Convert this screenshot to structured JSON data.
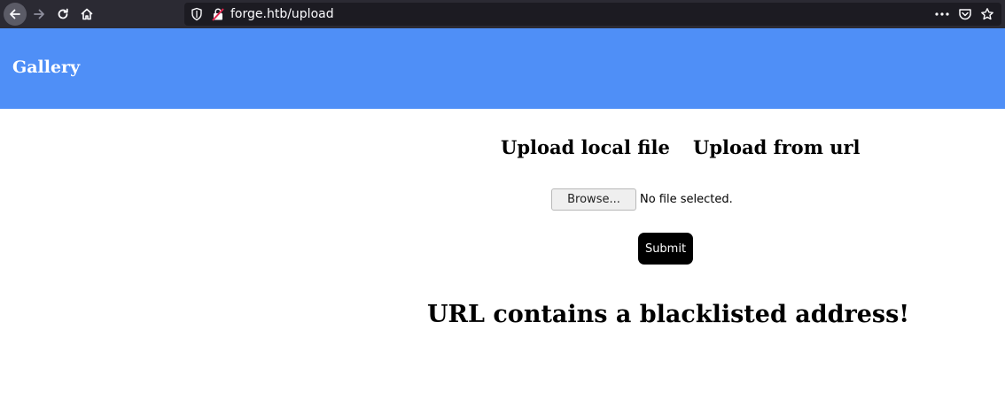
{
  "browser": {
    "url": "forge.htb/upload",
    "icons": {
      "back": "back-arrow-icon",
      "forward": "forward-arrow-icon",
      "reload": "reload-icon",
      "home": "home-icon",
      "tracking": "shield-icon",
      "security": "insecure-lock-icon",
      "page_actions": "more-actions-icon",
      "pocket": "pocket-icon",
      "bookmark": "bookmark-star-icon"
    }
  },
  "header": {
    "brand": "Gallery",
    "background_color": "#4f8ff7"
  },
  "upload": {
    "tab_local": "Upload local file",
    "tab_url": "Upload from url",
    "browse_label": "Browse...",
    "file_status": "No file selected.",
    "submit_label": "Submit"
  },
  "message": "URL contains a blacklisted address!"
}
